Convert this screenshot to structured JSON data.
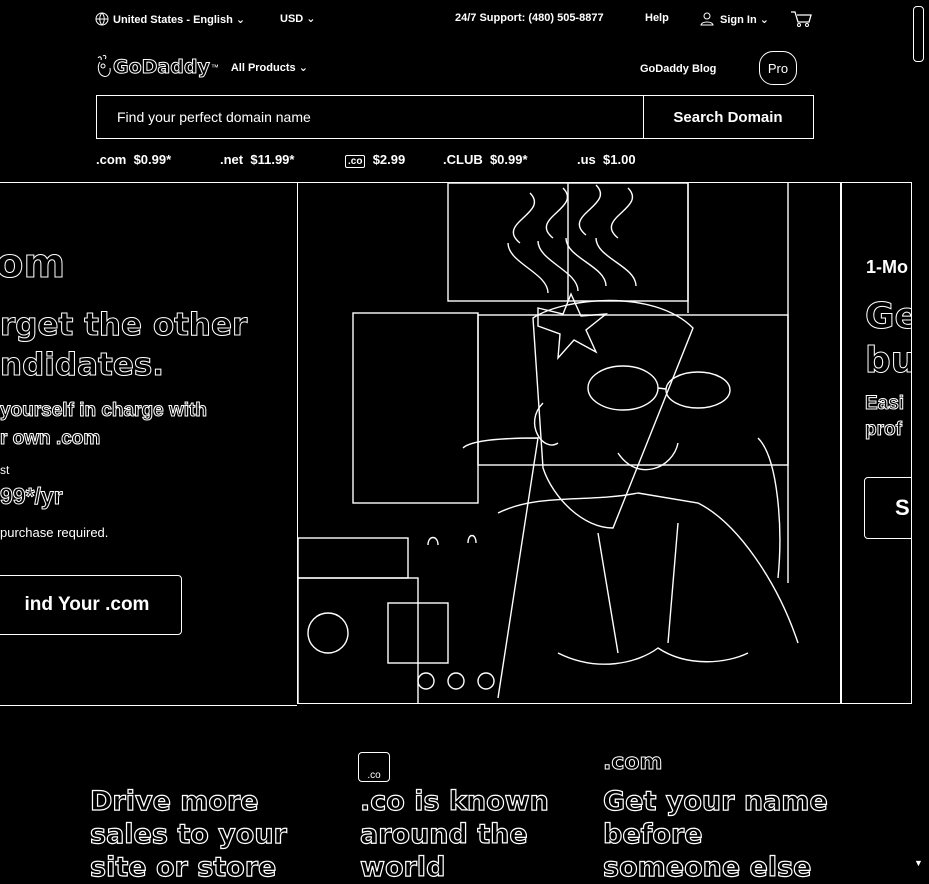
{
  "utility": {
    "locale": "United States - English",
    "currency": "USD",
    "support": "24/7 Support: (480) 505-8877",
    "help": "Help",
    "sign_in": "Sign In"
  },
  "nav": {
    "brand": "GoDaddy",
    "all_products": "All Products",
    "blog": "GoDaddy Blog",
    "pro": "Pro"
  },
  "search": {
    "placeholder": "Find your perfect domain name",
    "button": "Search Domain"
  },
  "tlds": [
    {
      "name": ".com",
      "price": "$0.99*"
    },
    {
      "name": ".net",
      "price": "$11.99*"
    },
    {
      "name": ".co",
      "price": "$2.99"
    },
    {
      "name": ".CLUB",
      "price": "$0.99*"
    },
    {
      "name": ".us",
      "price": "$1.00"
    }
  ],
  "hero": {
    "logo_text": "om",
    "headline_1": "rget the other",
    "headline_2": "ndidates.",
    "sub_1": "yourself in charge with",
    "sub_2": "r own .com",
    "price_label": "st",
    "price": "99*/yr",
    "note": "purchase required.",
    "cta": "ind Your .com"
  },
  "hero_right": {
    "kicker": "1-Mo",
    "title_1": "Ge",
    "title_2": "bu",
    "sub_1": "Easi",
    "sub_2": "prof",
    "cta": "S"
  },
  "promos": [
    {
      "badge": "",
      "title_1": "Drive more",
      "title_2": "sales to your",
      "title_3": "site or store"
    },
    {
      "badge": ".co",
      "title_1": ".co is known",
      "title_2": "around the",
      "title_3": "world"
    },
    {
      "badge": ".com",
      "title_1": "Get your name",
      "title_2": "before",
      "title_3": "someone else"
    }
  ]
}
